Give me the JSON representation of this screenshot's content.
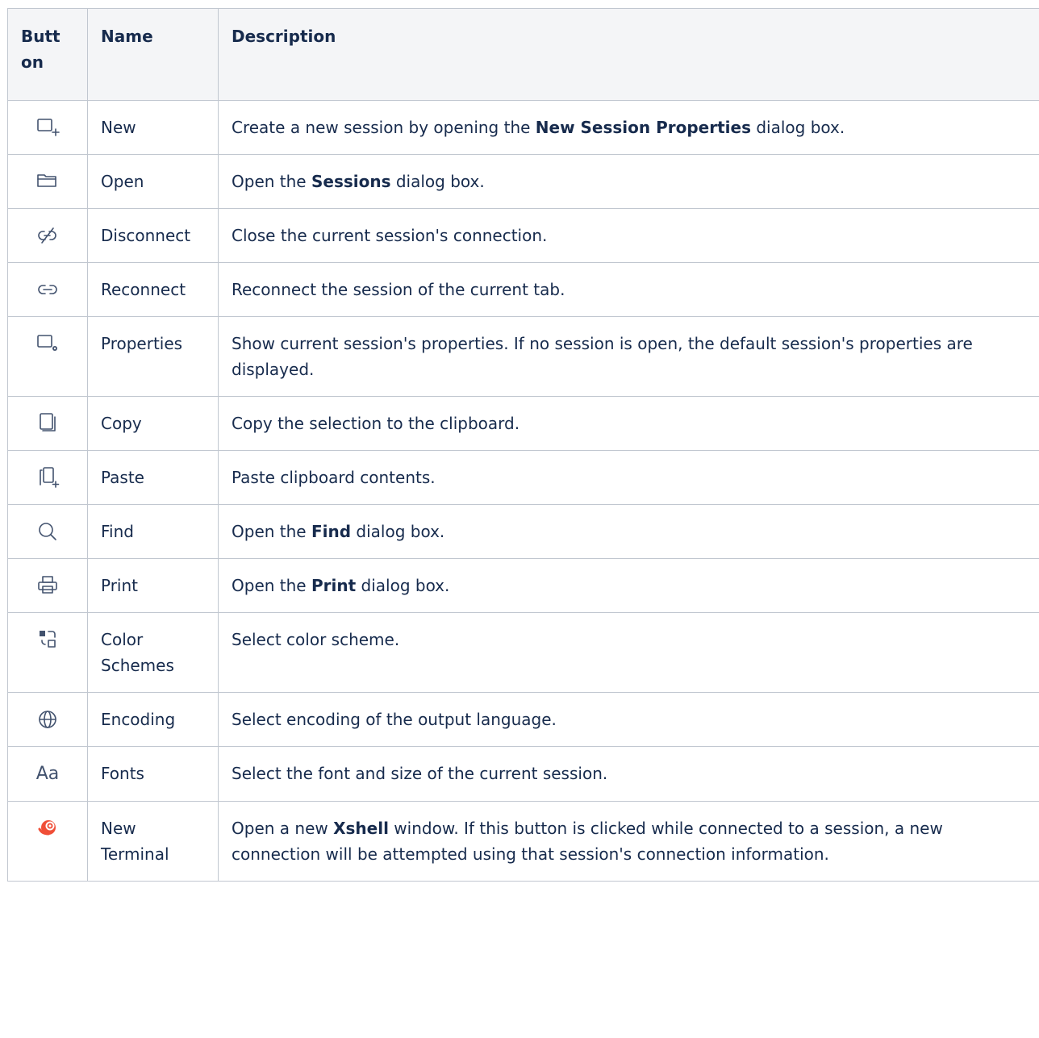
{
  "header": {
    "button": "Butt on",
    "name": "Name",
    "description": "Description"
  },
  "rows": [
    {
      "icon": "new-session-icon",
      "name": "New",
      "desc": [
        {
          "t": "Create a new session by opening the "
        },
        {
          "t": "New Session Properties",
          "b": true
        },
        {
          "t": " dialog box."
        }
      ]
    },
    {
      "icon": "open-folder-icon",
      "name": "Open",
      "desc": [
        {
          "t": "Open the "
        },
        {
          "t": "Sessions",
          "b": true
        },
        {
          "t": " dialog box."
        }
      ]
    },
    {
      "icon": "disconnect-link-icon",
      "name": "Disconnect",
      "desc": [
        {
          "t": "Close the current session's connection."
        }
      ]
    },
    {
      "icon": "link-icon",
      "name": "Reconnect",
      "desc": [
        {
          "t": "Reconnect the session of the current tab."
        }
      ]
    },
    {
      "icon": "session-properties-icon",
      "name": "Properties",
      "desc": [
        {
          "t": "Show current session's properties. If no session is open, the default session's properties are displayed."
        }
      ]
    },
    {
      "icon": "copy-icon",
      "name": "Copy",
      "desc": [
        {
          "t": "Copy the selection to the clipboard."
        }
      ]
    },
    {
      "icon": "paste-icon",
      "name": "Paste",
      "desc": [
        {
          "t": "Paste clipboard contents."
        }
      ]
    },
    {
      "icon": "search-icon",
      "name": "Find",
      "desc": [
        {
          "t": "Open the "
        },
        {
          "t": "Find",
          "b": true
        },
        {
          "t": " dialog box."
        }
      ]
    },
    {
      "icon": "printer-icon",
      "name": "Print",
      "desc": [
        {
          "t": "Open the "
        },
        {
          "t": "Print",
          "b": true
        },
        {
          "t": " dialog box."
        }
      ]
    },
    {
      "icon": "color-scheme-icon",
      "name": "Color Schemes",
      "desc": [
        {
          "t": "Select color scheme."
        }
      ]
    },
    {
      "icon": "globe-icon",
      "name": "Encoding",
      "desc": [
        {
          "t": "Select encoding of the output language."
        }
      ]
    },
    {
      "icon": "font-icon",
      "name": "Fonts",
      "desc": [
        {
          "t": "Select the font and size of the current session."
        }
      ]
    },
    {
      "icon": "xshell-logo-icon",
      "name": "New Terminal",
      "desc": [
        {
          "t": "Open a new "
        },
        {
          "t": "Xshell",
          "b": true
        },
        {
          "t": " window. If this button is clicked while connected to a session, a new connection will be attempted using that session's connection information."
        }
      ]
    }
  ],
  "icon_text": {
    "font-icon": "Aa"
  },
  "colors": {
    "border": "#c1c7d0",
    "header_bg": "#f4f5f7",
    "text": "#172b4d",
    "icon": "#42526e",
    "xshell": "#f04e37"
  }
}
